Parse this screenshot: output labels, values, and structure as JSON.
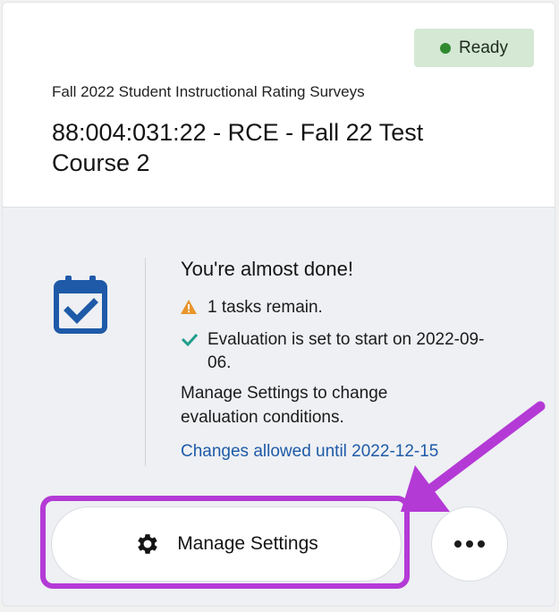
{
  "badge": {
    "label": "Ready",
    "color": "#2f8a2f"
  },
  "card": {
    "subtitle": "Fall 2022 Student Instructional Rating Surveys",
    "title": "88:004:031:22 - RCE - Fall 22 Test Course 2"
  },
  "status": {
    "heading": "You're almost done!",
    "tasks": "1 tasks remain.",
    "evaluation": "Evaluation is set to start on 2022-09-06.",
    "manage_note": "Manage Settings to change evaluation conditions.",
    "changes_link": "Changes allowed until 2022-12-15"
  },
  "actions": {
    "manage_label": "Manage Settings",
    "more_icon": "ellipsis-icon"
  },
  "colors": {
    "accent": "#1e5aa8",
    "highlight": "#b43ad6",
    "warning": "#e8952a",
    "success": "#1f9d8a"
  }
}
